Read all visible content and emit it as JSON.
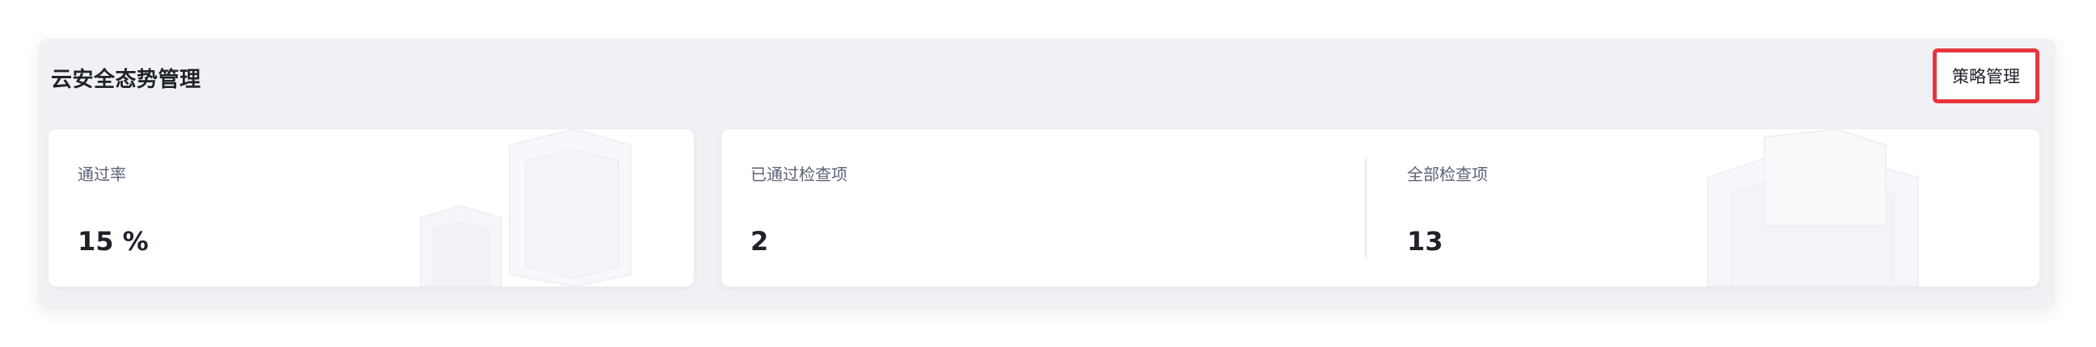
{
  "panel": {
    "title": "云安全态势管理",
    "policy_button_label": "策略管理"
  },
  "metrics": {
    "pass_rate": {
      "label": "通过率",
      "value": "15 %"
    },
    "passed_checks": {
      "label": "已通过检查项",
      "value": "2"
    },
    "all_checks": {
      "label": "全部检查项",
      "value": "13"
    }
  },
  "colors": {
    "panel_bg": "#f0f1f4",
    "highlight_border": "#e8353c",
    "text_primary": "#1f2329",
    "text_secondary": "#5b6275"
  }
}
